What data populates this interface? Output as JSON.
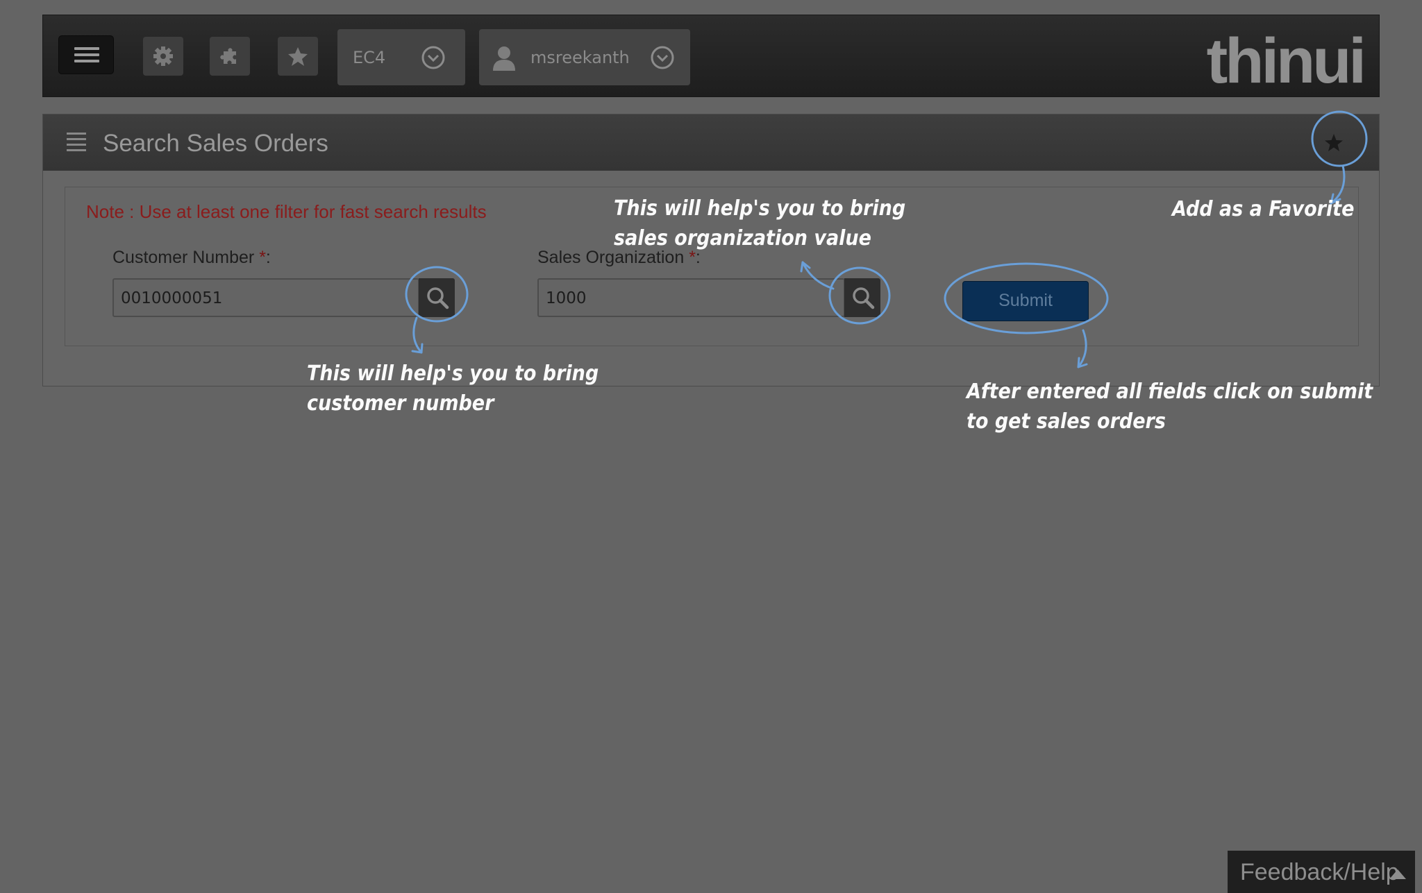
{
  "toolbar": {
    "system": "EC4",
    "user": "msreekanth",
    "logo": "thinui"
  },
  "panel": {
    "title": "Search Sales Orders"
  },
  "form": {
    "note": "Note : Use at least one filter for fast search results",
    "customer_number": {
      "label": "Customer Number",
      "required_mark": "*",
      "suffix": ":",
      "value": "0010000051"
    },
    "sales_org": {
      "label": "Sales Organization",
      "required_mark": "*",
      "suffix": ":",
      "value": "1000"
    },
    "submit_label": "Submit"
  },
  "annotations": {
    "favorite": "Add as a Favorite",
    "sales_org_help_1": "This will help's you to bring",
    "sales_org_help_2": "sales organization value",
    "customer_help_1": "This will help's you to bring",
    "customer_help_2": "customer number",
    "submit_help_1": "After entered all fields click on submit",
    "submit_help_2": "to get sales orders"
  },
  "feedback": {
    "label": "Feedback/Help"
  },
  "icons": [
    "menu-icon",
    "gear-icon",
    "puzzle-icon",
    "star-icon",
    "chevron-down-icon",
    "user-icon",
    "list-icon",
    "search-icon",
    "caret-up-icon"
  ],
  "colors": {
    "background": "#646464",
    "note_red": "#8a1c1c",
    "submit_blue": "#0a2f55",
    "annotation_circle": "#6a9fd8"
  }
}
